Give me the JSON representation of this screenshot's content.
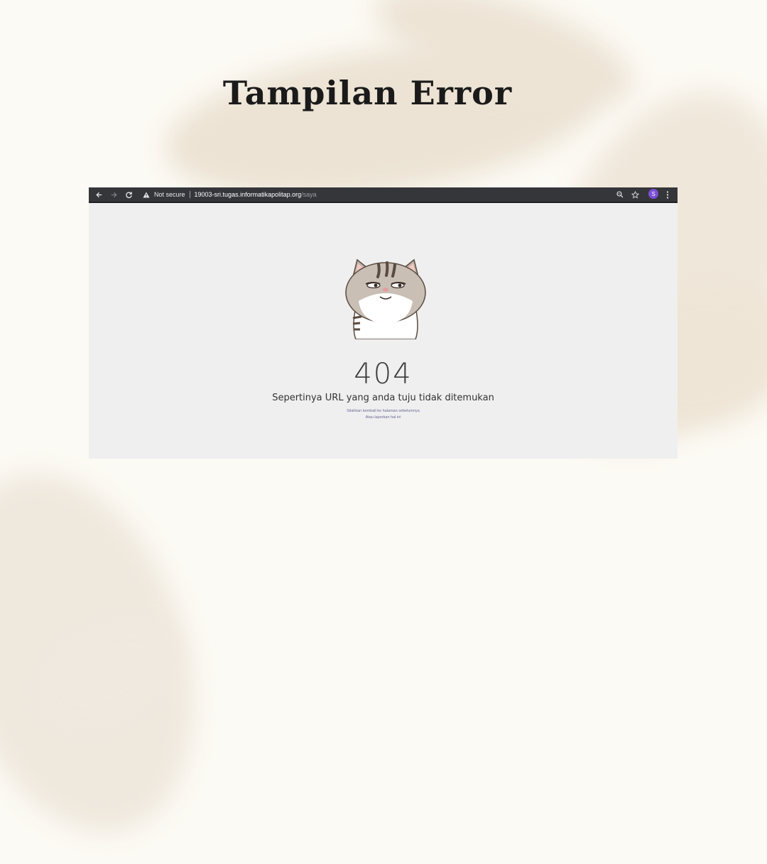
{
  "slide": {
    "title": "Tampilan Error"
  },
  "browser": {
    "security_label": "Not secure",
    "url_host": "19003-sri.tugas.informatikapolitap.org",
    "url_path": "/saya",
    "profile_initial": "S",
    "icons": [
      "back-arrow-icon",
      "forward-arrow-icon",
      "reload-icon",
      "warning-icon",
      "zoom-icon",
      "star-icon",
      "menu-dots-icon"
    ],
    "colors": {
      "toolbar": "#35363a",
      "avatar": "#7b4fd6",
      "page_bg": "#efefef"
    }
  },
  "page": {
    "error_code": "404",
    "message": "Sepertinya URL yang anda tuju tidak ditemukan",
    "back_link": "Silahkan kembali ke halaman sebelumnya",
    "report_link": "Atau laporkan hal ini",
    "illustration": "cat-illustration"
  }
}
